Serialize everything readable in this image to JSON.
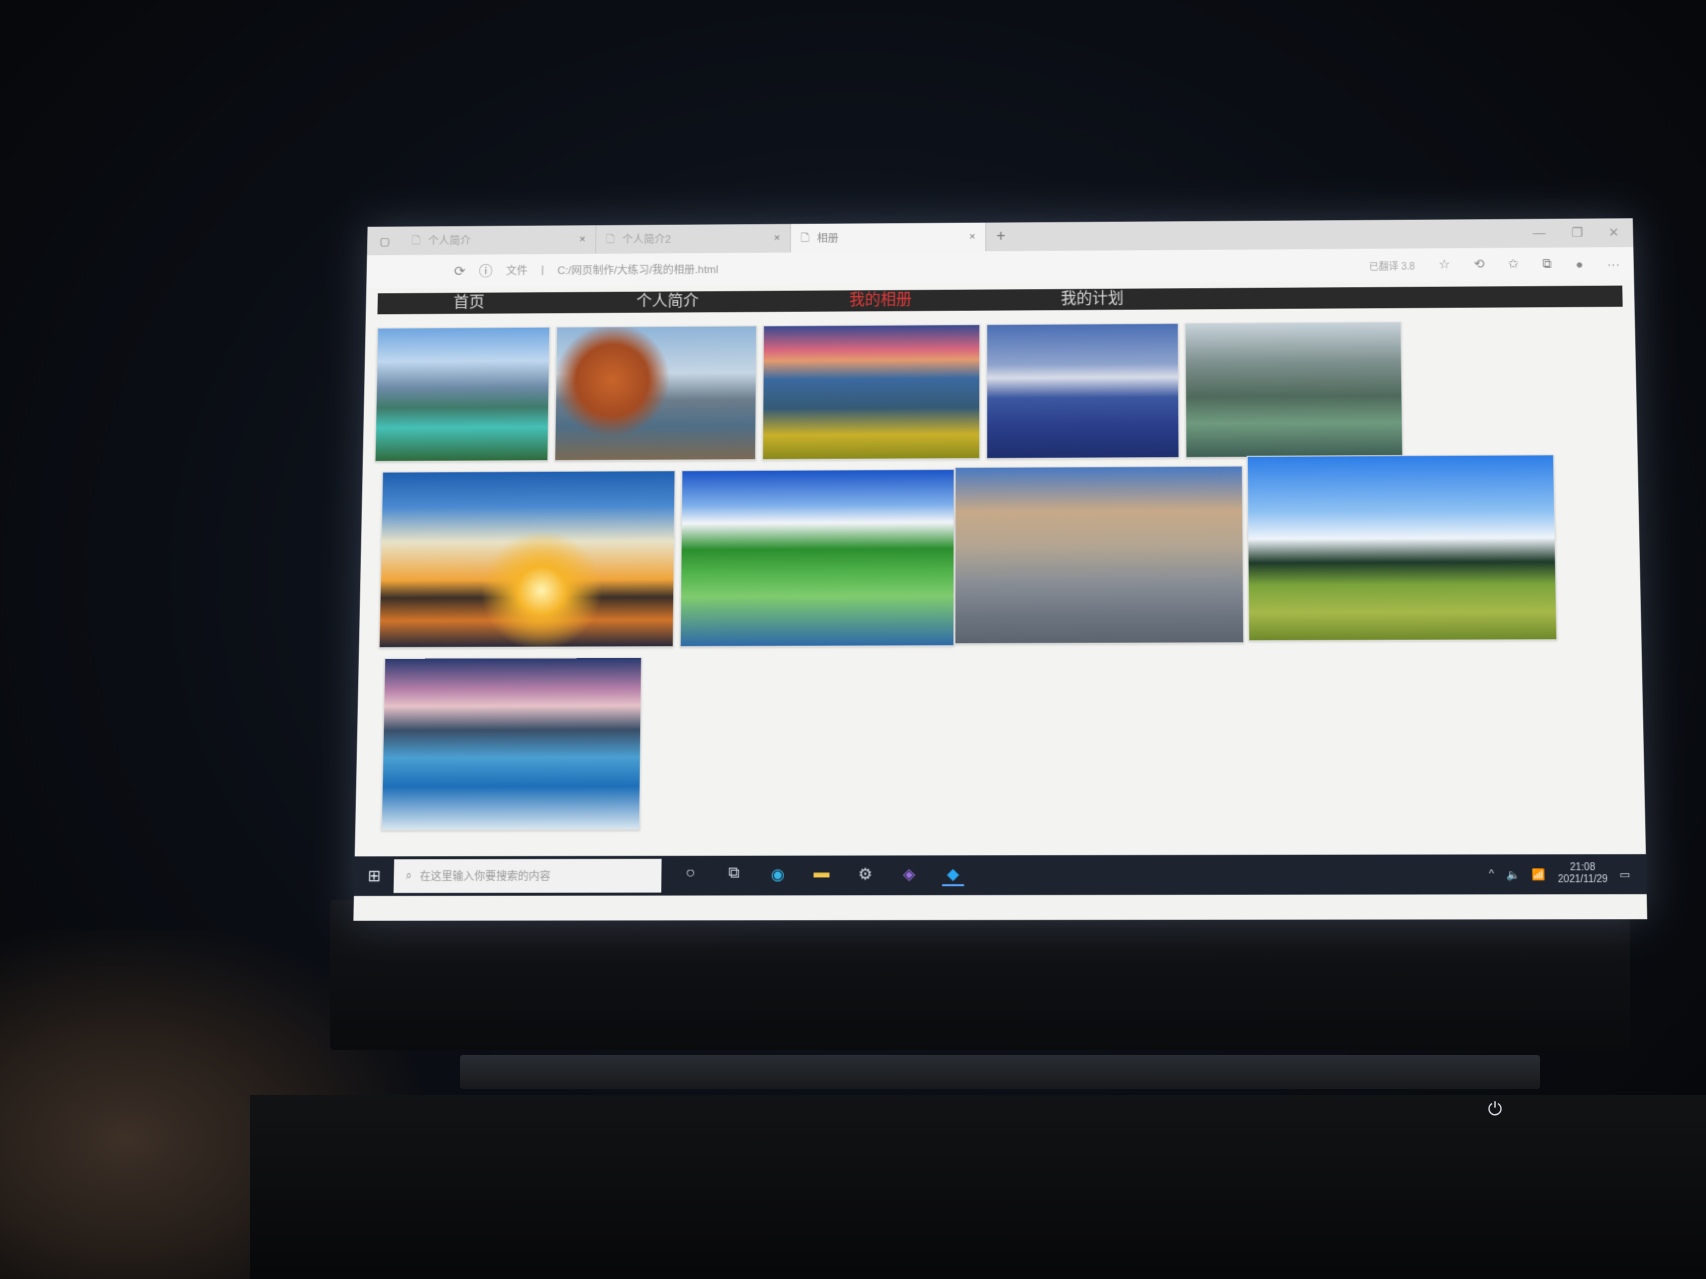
{
  "browser": {
    "tabs": [
      {
        "title": "个人简介",
        "active": false
      },
      {
        "title": "个人简介2",
        "active": false
      },
      {
        "title": "相册",
        "active": true
      }
    ],
    "address": {
      "scheme_label": "文件",
      "url": "C:/网页制作/大练习/我的相册.html"
    },
    "toolbar_text": "已翻译 3.8"
  },
  "site": {
    "nav": {
      "home": "首页",
      "profile": "个人简介",
      "album": "我的相册",
      "plan": "我的计划"
    },
    "active_nav": "album",
    "active_color": "#e33a3a"
  },
  "gallery": {
    "photos": [
      {
        "subject": "lake-clouds"
      },
      {
        "subject": "autumn-tree-lake"
      },
      {
        "subject": "mountain-sunset-flowers"
      },
      {
        "subject": "blue-lake-mist"
      },
      {
        "subject": "karst-river-fog"
      },
      {
        "subject": "sunset-sea"
      },
      {
        "subject": "green-lake-village"
      },
      {
        "subject": "aerial-river-valley"
      },
      {
        "subject": "green-meadow-sky"
      },
      {
        "subject": "waterfall-long-exposure"
      }
    ]
  },
  "taskbar": {
    "search_placeholder": "在这里输入你要搜索的内容",
    "clock": {
      "time": "21:08",
      "date": "2021/11/29"
    }
  }
}
